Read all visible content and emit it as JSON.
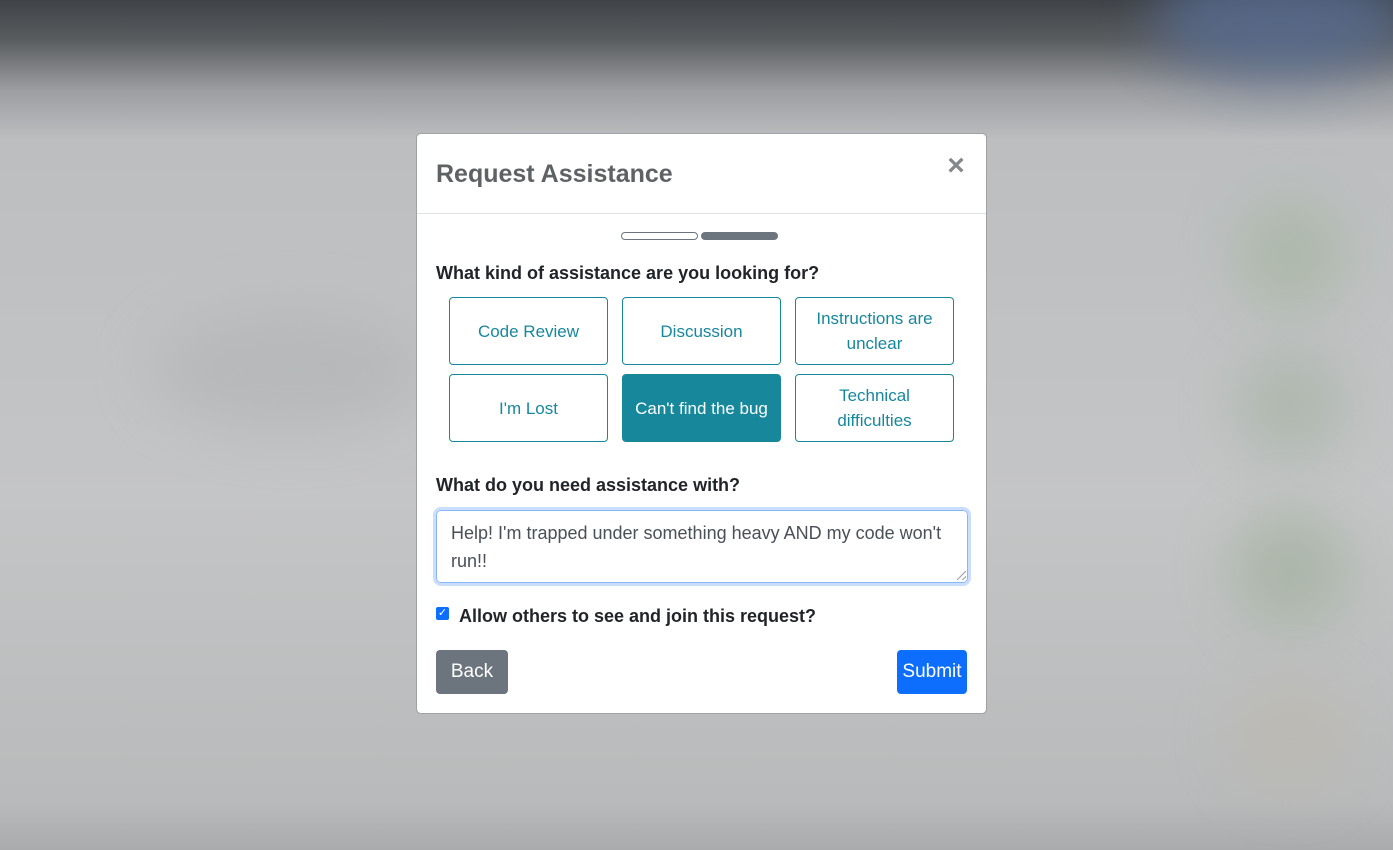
{
  "modal": {
    "title": "Request Assistance",
    "close_symbol": "×",
    "close_icon": "close-icon"
  },
  "steps": {
    "total": 2,
    "current": 2
  },
  "assistance_type": {
    "question": "What kind of assistance are you looking for?",
    "options": [
      {
        "label": "Code Review",
        "selected": false
      },
      {
        "label": "Discussion",
        "selected": false
      },
      {
        "label": "Instructions are unclear",
        "selected": false
      },
      {
        "label": "I'm Lost",
        "selected": false
      },
      {
        "label": "Can't find the bug",
        "selected": true
      },
      {
        "label": "Technical difficulties",
        "selected": false
      }
    ]
  },
  "details": {
    "question": "What do you need assistance with?",
    "value": "Help! I'm trapped under something heavy AND my code won't run!!"
  },
  "visibility": {
    "label": "Allow others to see and join this request?",
    "checked": true
  },
  "footer": {
    "back_label": "Back",
    "submit_label": "Submit"
  },
  "colors": {
    "accent": "#17879c",
    "primary": "#0d6efd",
    "secondary": "#6c757d"
  }
}
